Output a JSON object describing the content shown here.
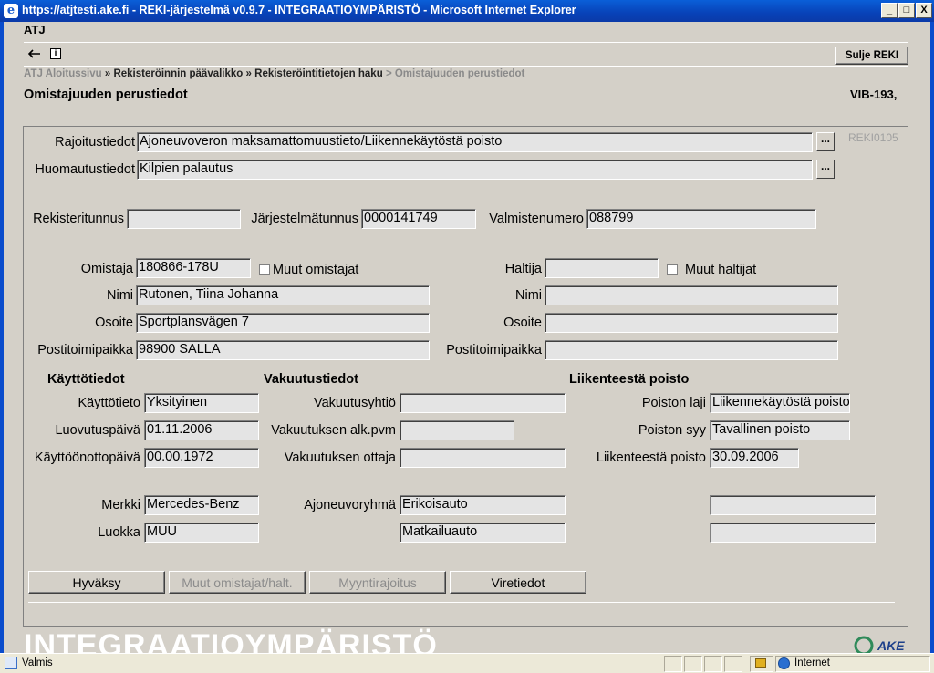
{
  "window": {
    "title": "https://atjtesti.ake.fi - REKI-järjestelmä v0.9.7 - INTEGRAATIOYMPÄRISTÖ - Microsoft Internet Explorer",
    "minimize": "_",
    "maximize": "□",
    "close": "X"
  },
  "app": {
    "name": "ATJ"
  },
  "toolbar": {
    "close_reki": "Sulje REKI"
  },
  "breadcrumb": {
    "home": "ATJ Aloitussivu",
    "sep": "»",
    "main_menu": "Rekisteröinnin päävalikko",
    "search": "Rekisteröintitietojen haku",
    "sep2": ">",
    "current": "Omistajuuden perustiedot"
  },
  "page": {
    "title": "Omistajuuden perustiedot",
    "plate": "VIB-193,"
  },
  "screen_id": "REKI0105",
  "fields": {
    "rajoitustiedot": {
      "label": "Rajoitustiedot",
      "value": "Ajoneuvoveron maksamattomuustieto/Liikennekäytöstä poisto"
    },
    "huomautustiedot": {
      "label": "Huomautustiedot",
      "value": "Kilpien palautus"
    },
    "rekisteritunnus": {
      "label": "Rekisteritunnus",
      "value": ""
    },
    "jarjestelmatunnus": {
      "label": "Järjestelmätunnus",
      "value": "0000141749"
    },
    "valmistenumero": {
      "label": "Valmistenumero",
      "value": "088799"
    },
    "omistaja": {
      "label": "Omistaja",
      "value": "180866-178U",
      "others_label": "Muut omistajat"
    },
    "omistaja_nimi": {
      "label": "Nimi",
      "value": "Rutonen, Tiina Johanna"
    },
    "omistaja_osoite": {
      "label": "Osoite",
      "value": "Sportplansvägen 7"
    },
    "omistaja_posti": {
      "label": "Postitoimipaikka",
      "value": "98900 SALLA"
    },
    "haltija": {
      "label": "Haltija",
      "value": "",
      "others_label": "Muut haltijat"
    },
    "haltija_nimi": {
      "label": "Nimi",
      "value": ""
    },
    "haltija_osoite": {
      "label": "Osoite",
      "value": ""
    },
    "haltija_posti": {
      "label": "Postitoimipaikka",
      "value": ""
    }
  },
  "kaytto": {
    "heading": "Käyttötiedot",
    "kayttotieto": {
      "label": "Käyttötieto",
      "value": "Yksityinen"
    },
    "luovutuspaiva": {
      "label": "Luovutuspäivä",
      "value": "01.11.2006"
    },
    "kayttoonotto": {
      "label": "Käyttöönottopäivä",
      "value": "00.00.1972"
    }
  },
  "vakuutus": {
    "heading": "Vakuutustiedot",
    "yhtio": {
      "label": "Vakuutusyhtiö",
      "value": ""
    },
    "alkpvm": {
      "label": "Vakuutuksen alk.pvm",
      "value": ""
    },
    "ottaja": {
      "label": "Vakuutuksen ottaja",
      "value": ""
    }
  },
  "poisto": {
    "heading": "Liikenteestä poisto",
    "laji": {
      "label": "Poiston laji",
      "value": "Liikennekäytöstä poisto"
    },
    "syy": {
      "label": "Poiston syy",
      "value": "Tavallinen poisto"
    },
    "pvm": {
      "label": "Liikenteestä poisto",
      "value": "30.09.2006"
    }
  },
  "vehicle": {
    "merkki": {
      "label": "Merkki",
      "value": "Mercedes-Benz"
    },
    "luokka": {
      "label": "Luokka",
      "value": "MUU"
    },
    "ajoneuvoryhma": {
      "label": "Ajoneuvoryhmä",
      "value": "Erikoisauto"
    },
    "ajoneuvoryhma2": {
      "value": "Matkailuauto"
    },
    "extra1": {
      "value": ""
    },
    "extra2": {
      "value": ""
    }
  },
  "buttons": {
    "hyvaksy": "Hyväksy",
    "muut": "Muut omistajat/halt.",
    "myyntirajoitus": "Myyntirajoitus",
    "viretiedot": "Viretiedot",
    "more": "..."
  },
  "footer": {
    "watermark": "INTEGRAATIOYMPÄRISTÖ",
    "logo": "AKE"
  },
  "status": {
    "text": "Valmis",
    "zone": "Internet"
  }
}
